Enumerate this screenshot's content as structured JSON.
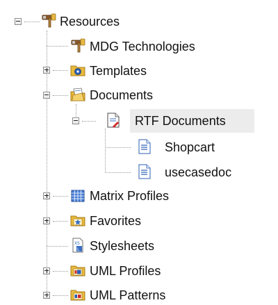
{
  "tree": {
    "nodes": [
      {
        "id": "resources",
        "label": "Resources",
        "icon": "hammer-icon",
        "expanded": true,
        "selected": false
      },
      {
        "id": "mdg",
        "label": "MDG Technologies",
        "icon": "hammer-icon",
        "selected": false
      },
      {
        "id": "templates",
        "label": "Templates",
        "icon": "template-folder-icon",
        "expanded": false,
        "selected": false
      },
      {
        "id": "documents",
        "label": "Documents",
        "icon": "documents-folder-icon",
        "expanded": true,
        "selected": false
      },
      {
        "id": "rtf",
        "label": "RTF Documents",
        "icon": "rtf-document-icon",
        "expanded": true,
        "selected": true
      },
      {
        "id": "shopcart",
        "label": "Shopcart",
        "icon": "document-icon",
        "selected": false
      },
      {
        "id": "usecasedoc",
        "label": "usecasedoc",
        "icon": "document-icon",
        "selected": false
      },
      {
        "id": "matrix",
        "label": "Matrix Profiles",
        "icon": "matrix-icon",
        "expanded": false,
        "selected": false
      },
      {
        "id": "favorites",
        "label": "Favorites",
        "icon": "favorites-folder-icon",
        "expanded": false,
        "selected": false
      },
      {
        "id": "stylesheets",
        "label": "Stylesheets",
        "icon": "stylesheet-icon",
        "selected": false
      },
      {
        "id": "umlprofiles",
        "label": "UML Profiles",
        "icon": "uml-profiles-folder-icon",
        "expanded": false,
        "selected": false
      },
      {
        "id": "umlpatterns",
        "label": "UML Patterns",
        "icon": "uml-patterns-folder-icon",
        "expanded": false,
        "selected": false
      }
    ],
    "selection_color": "#ececec",
    "connector_color": "#9a9a9a",
    "folder_color": "#e8b93c",
    "document_accent": "#3a6fc4",
    "rtf_accent": "#d12b2b"
  }
}
